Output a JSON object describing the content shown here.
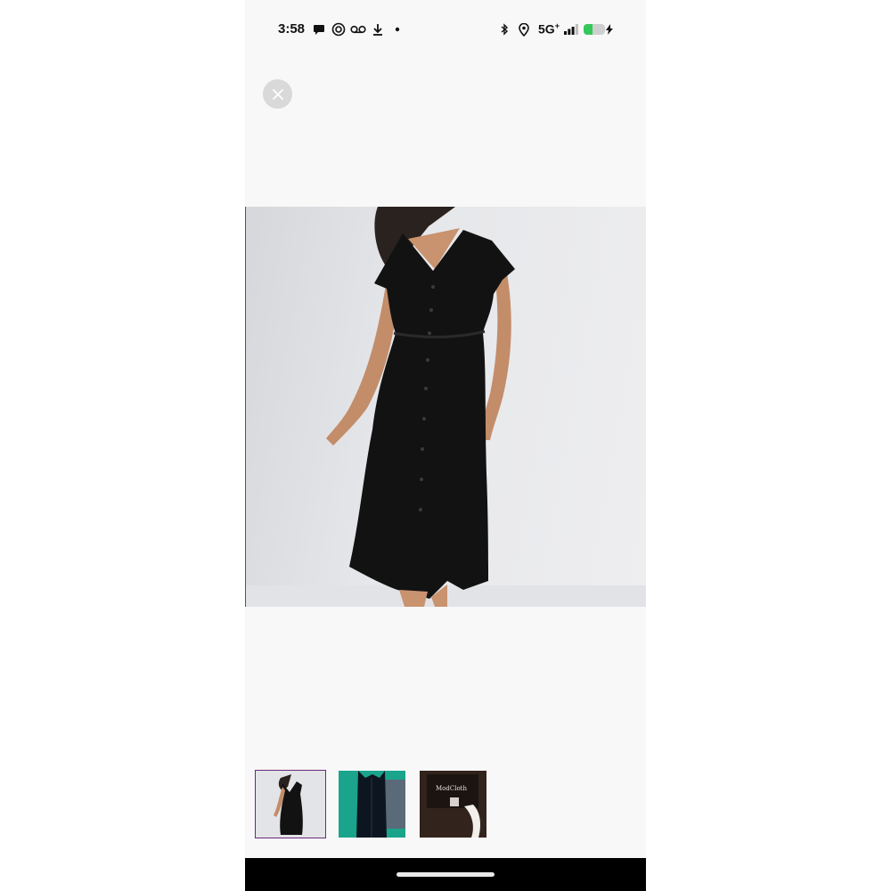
{
  "status_bar": {
    "time": "3:58",
    "network": "5G",
    "network_suffix": "+",
    "icons": [
      "chat-bubble-icon",
      "threads-icon",
      "voicemail-icon",
      "download-icon",
      "dot-icon",
      "bluetooth-icon",
      "location-icon",
      "signal-icon",
      "battery-icon",
      "charging-icon"
    ],
    "battery_level": 0.4
  },
  "viewer": {
    "close_icon": "close-icon",
    "main_image": "black-midi-dress-photo"
  },
  "thumbnails": [
    {
      "name": "dress-front-thumb",
      "selected": true
    },
    {
      "name": "dress-hanger-thumb",
      "selected": false
    },
    {
      "name": "dress-label-thumb",
      "selected": false,
      "label_text": "ModCloth"
    }
  ],
  "colors": {
    "selected_outline": "#6b2a7a",
    "battery_green": "#34c759"
  }
}
